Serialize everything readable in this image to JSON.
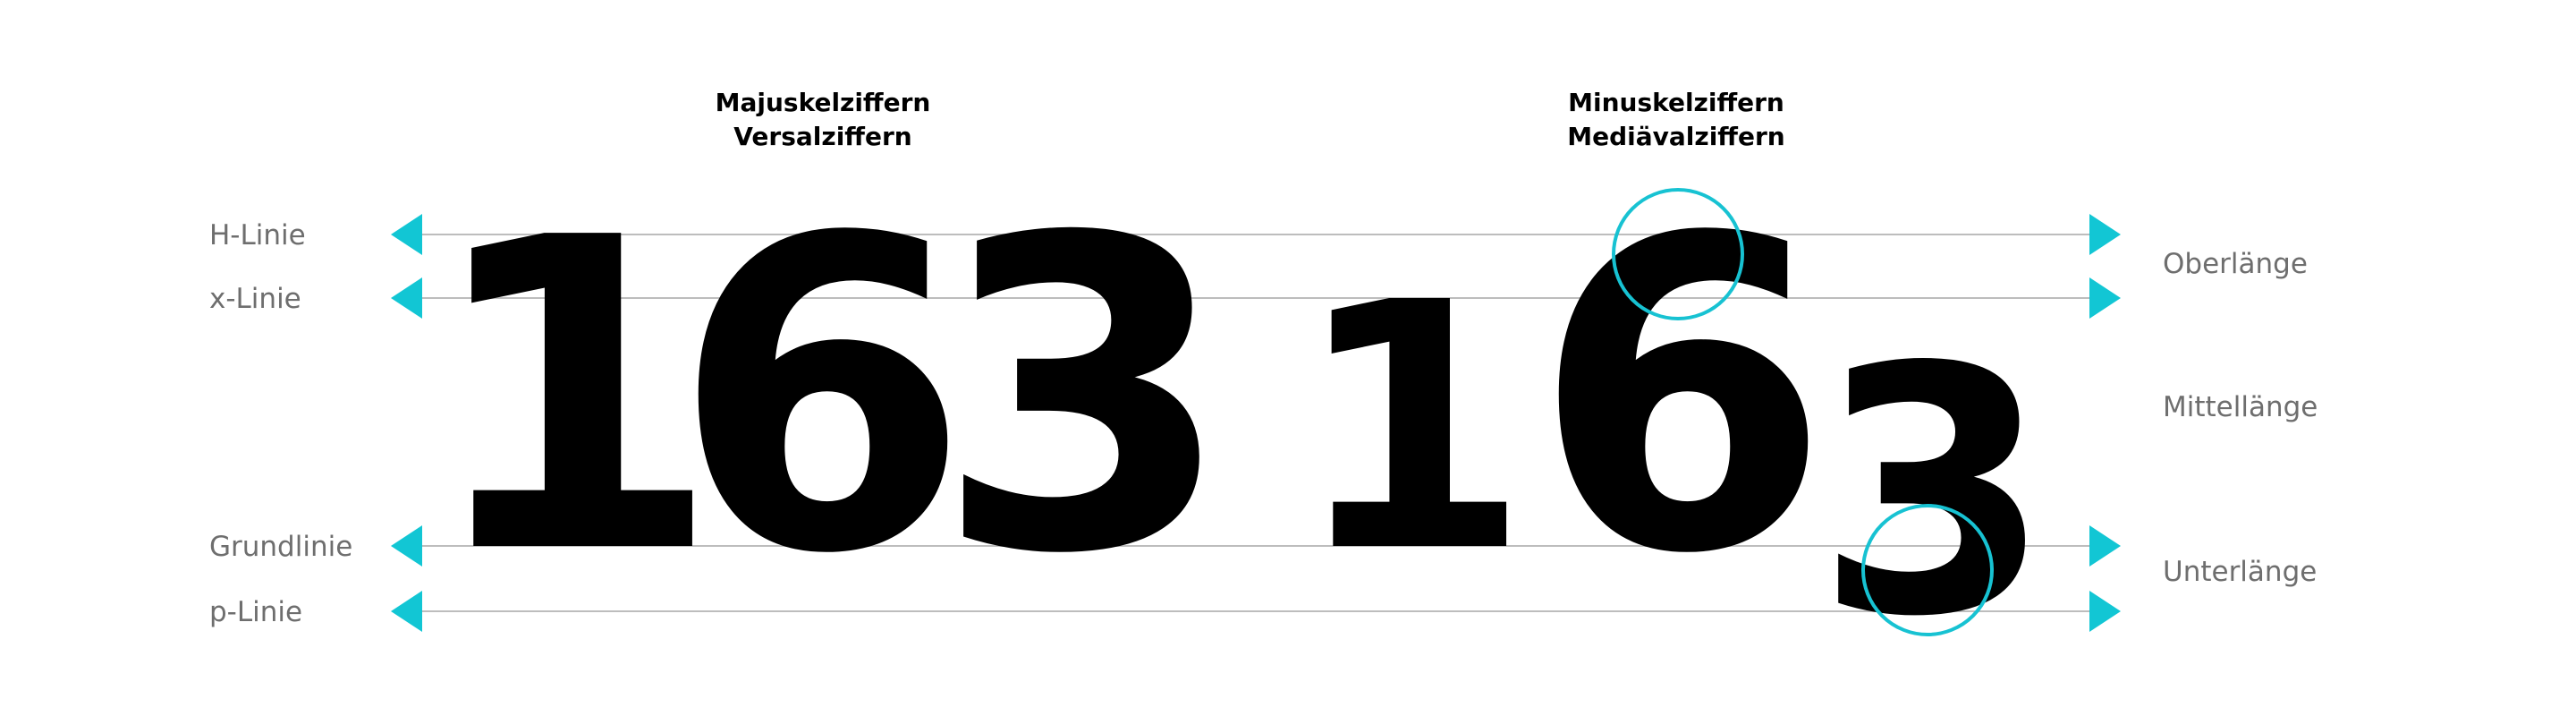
{
  "headings": {
    "lining": {
      "line1": "Majuskelziffern",
      "line2": "Versalziffern"
    },
    "oldstyle": {
      "line1": "Minuskelziffern",
      "line2": "Mediävalziffern"
    }
  },
  "guide_lines": [
    {
      "key": "h",
      "label": "H-Linie"
    },
    {
      "key": "x",
      "label": "x-Linie"
    },
    {
      "key": "base",
      "label": "Grundlinie"
    },
    {
      "key": "p",
      "label": "p-Linie"
    }
  ],
  "zones": {
    "ascender": "Oberlänge",
    "xheight": "Mittellänge",
    "descender": "Unterlänge"
  },
  "numerals": {
    "lining": [
      "1",
      "6",
      "3"
    ],
    "oldstyle": [
      "1",
      "6",
      "3"
    ]
  },
  "colors": {
    "accent": "#12c6d4",
    "guide": "#bdbdbd",
    "label": "#6e6e6e",
    "glyph": "#000000"
  }
}
